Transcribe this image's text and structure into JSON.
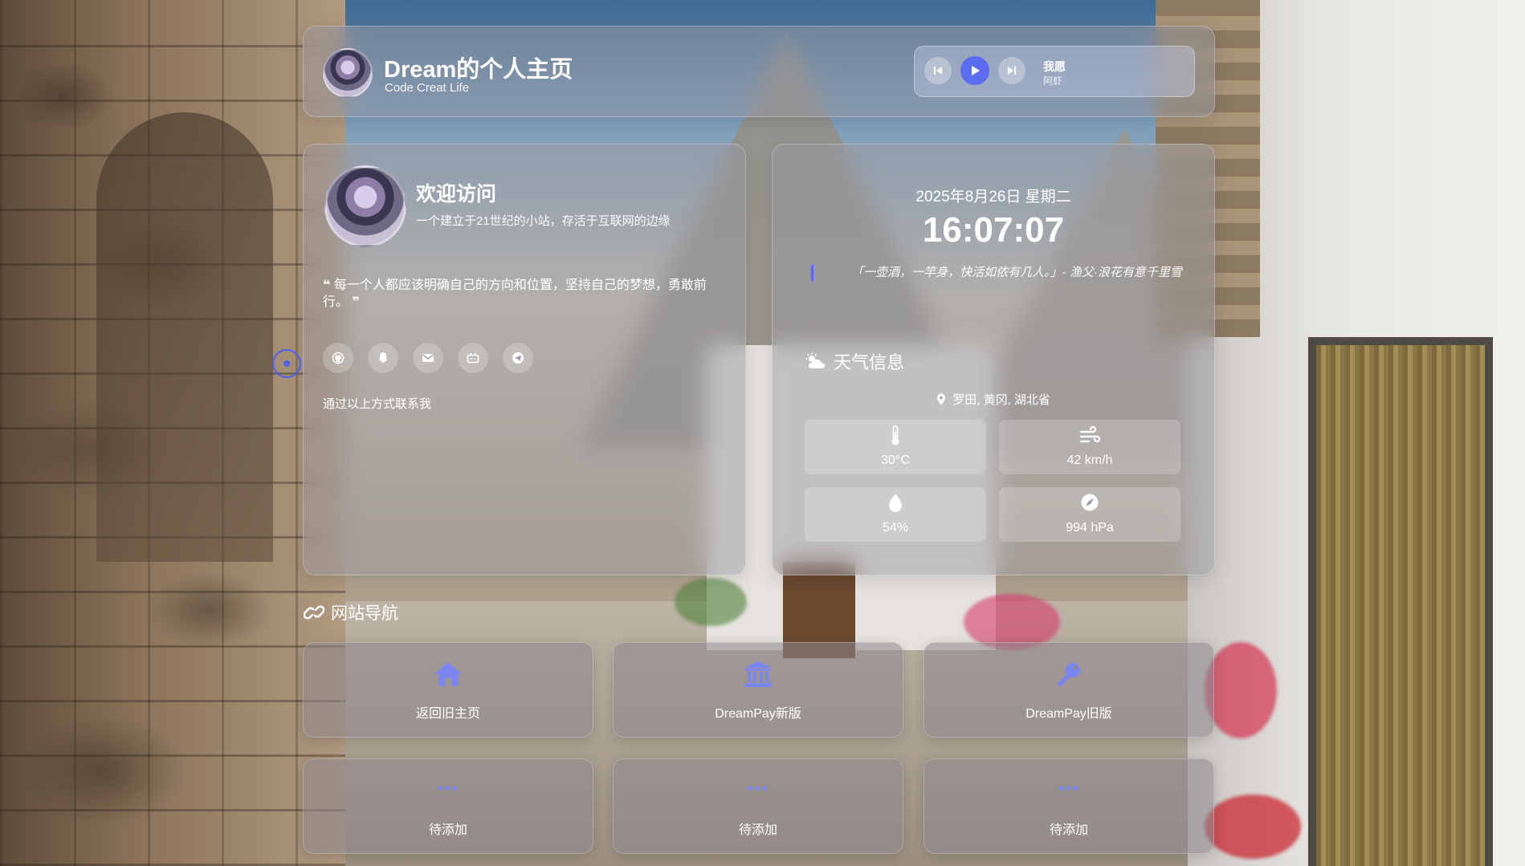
{
  "header": {
    "title": "Dream的个人主页",
    "subtitle": "Code Creat Life"
  },
  "player": {
    "song": "我愿",
    "artist": "阿虾",
    "controls": [
      "prev-icon",
      "play-icon",
      "next-icon"
    ]
  },
  "profile": {
    "welcome": "欢迎访问",
    "tagline": "一个建立于21世纪的小站，存活于互联网的边缘",
    "quote": "每一个人都应该明确自己的方向和位置，坚持自己的梦想，勇敢前行。",
    "quote_open": "❝",
    "quote_close": "❞",
    "socials": [
      "github-icon",
      "qq-icon",
      "email-icon",
      "bilibili-icon",
      "telegram-icon"
    ],
    "contact_note": "通过以上方式联系我"
  },
  "info": {
    "date": "2025年8月26日 星期二",
    "time": "16:07:07",
    "poem": "「一壶酒，一竿身，快活如侬有几人。」- 渔父·浪花有意千里雪",
    "weather_title": "天气信息",
    "location": "罗田, 黄冈, 湖北省",
    "weather": [
      {
        "icon": "thermometer-icon",
        "value": "30°C"
      },
      {
        "icon": "wind-icon",
        "value": "42 km/h"
      },
      {
        "icon": "humidity-icon",
        "value": "54%"
      },
      {
        "icon": "pressure-icon",
        "value": "994 hPa"
      }
    ]
  },
  "nav": {
    "title": "网站导航",
    "items": [
      {
        "label": "返回旧主页",
        "icon": "home-icon"
      },
      {
        "label": "DreamPay新版",
        "icon": "bank-icon"
      },
      {
        "label": "DreamPay旧版",
        "icon": "key-icon"
      },
      {
        "label": "待添加",
        "icon": "ellipsis-icon"
      },
      {
        "label": "待添加",
        "icon": "ellipsis-icon"
      },
      {
        "label": "待添加",
        "icon": "ellipsis-icon"
      }
    ]
  },
  "colors": {
    "accent": "#5b6cf0",
    "icon_accent": "#7b86f0"
  }
}
